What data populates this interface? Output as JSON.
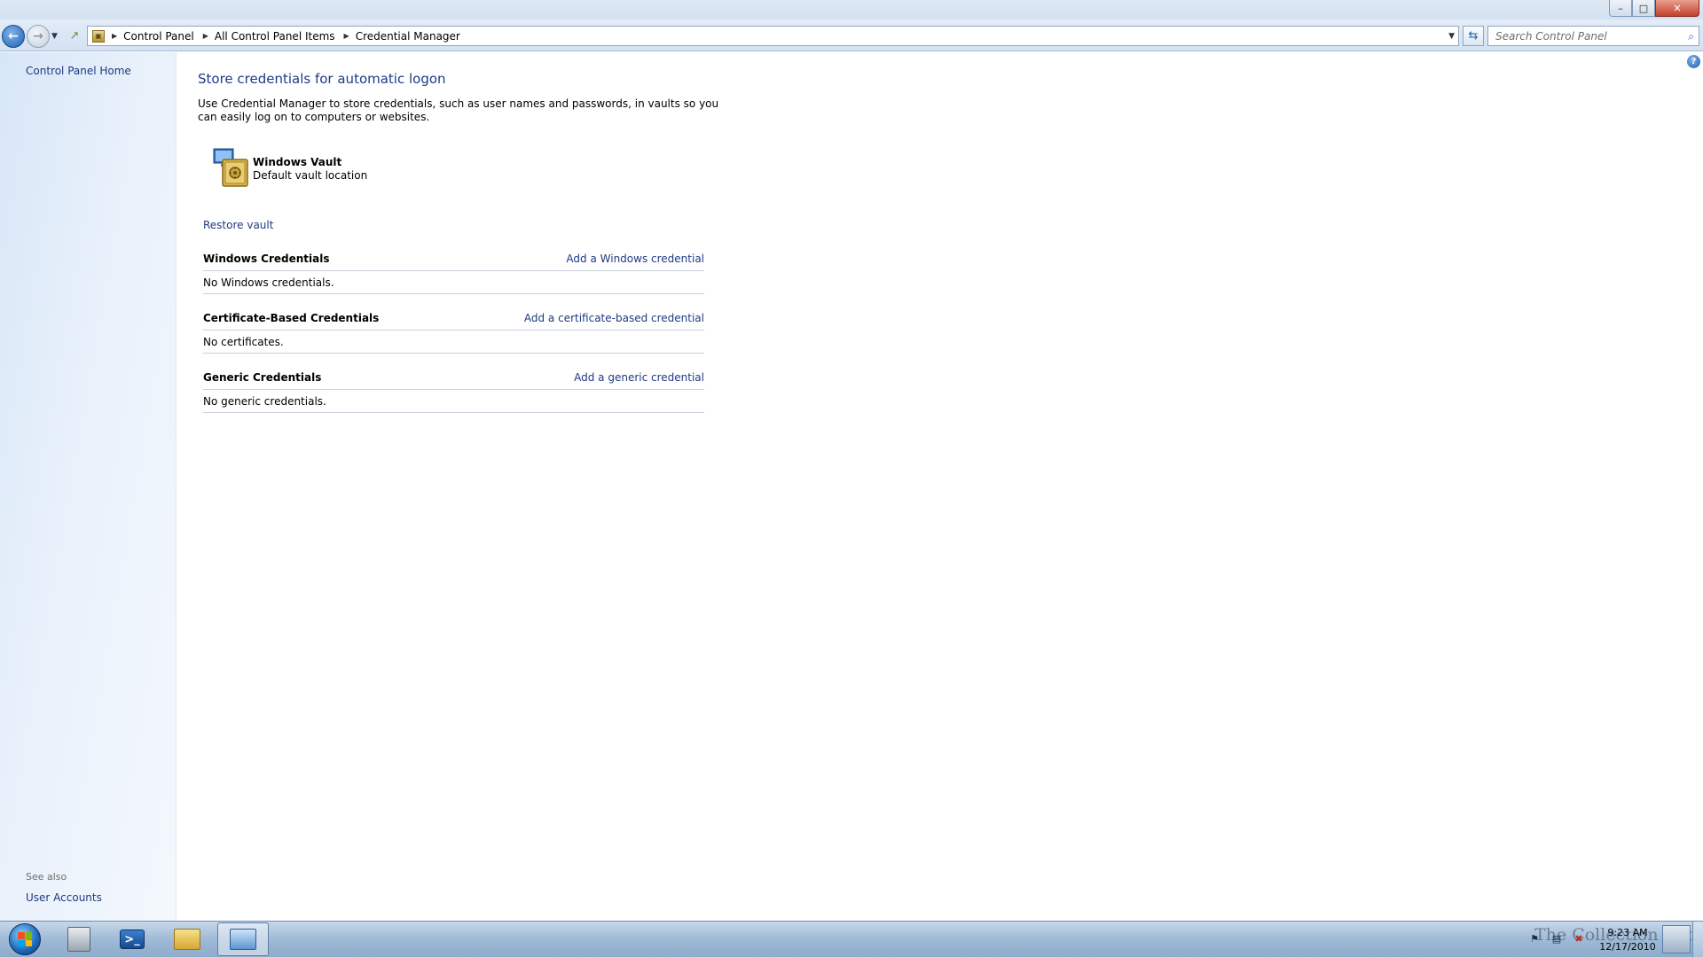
{
  "window": {
    "minimize_label": "–",
    "maximize_label": "□",
    "close_label": "✕"
  },
  "nav": {
    "back_label": "←",
    "forward_label": "→",
    "history_dropdown": "▼",
    "breadcrumbs": [
      "Control Panel",
      "All Control Panel Items",
      "Credential Manager"
    ],
    "crumb_separator": "▶",
    "address_dropdown": "▼",
    "refresh_label": "⇆",
    "search_placeholder": "Search Control Panel",
    "search_value": ""
  },
  "sidebar": {
    "home_link": "Control Panel Home",
    "see_also_label": "See also",
    "see_also_links": [
      "User Accounts"
    ]
  },
  "help": {
    "label": "?"
  },
  "main": {
    "title": "Store credentials for automatic logon",
    "description": "Use Credential Manager to store credentials, such as user names and passwords, in vaults so you can easily log on to computers or websites.",
    "vault": {
      "name": "Windows Vault",
      "subtitle": "Default vault location"
    },
    "restore_link": "Restore vault",
    "sections": [
      {
        "title": "Windows Credentials",
        "action": "Add a Windows credential",
        "empty_text": "No Windows credentials."
      },
      {
        "title": "Certificate-Based Credentials",
        "action": "Add a certificate-based credential",
        "empty_text": "No certificates."
      },
      {
        "title": "Generic Credentials",
        "action": "Add a generic credential",
        "empty_text": "No generic credentials."
      }
    ]
  },
  "taskbar": {
    "powershell_glyph": ">_",
    "tray": {
      "time": "9:23 AM",
      "date": "12/17/2010",
      "watermark": "The Collection Book"
    }
  }
}
